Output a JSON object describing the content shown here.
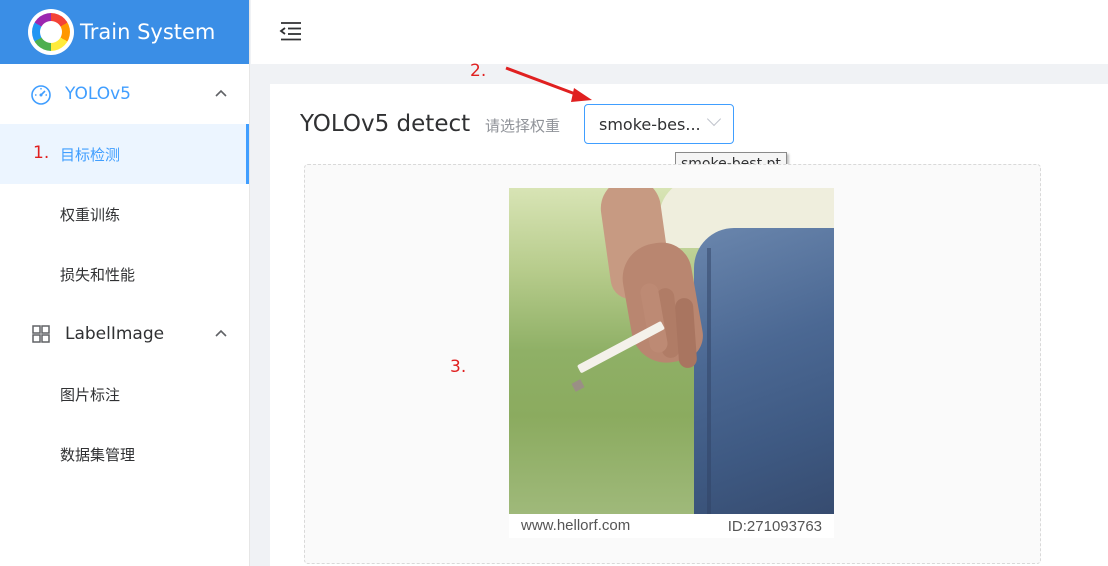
{
  "app": {
    "title": "Train System",
    "accent_color": "#409eff",
    "header_color": "#3a8ee6"
  },
  "sidebar": {
    "groups": [
      {
        "label": "YOLOv5",
        "icon": "dashboard-gauge-icon",
        "expanded": true,
        "items": [
          {
            "label": "目标检测",
            "active": true
          },
          {
            "label": "权重训练",
            "active": false
          },
          {
            "label": "损失和性能",
            "active": false
          }
        ]
      },
      {
        "label": "LabelImage",
        "icon": "grid-icon",
        "expanded": true,
        "items": [
          {
            "label": "图片标注",
            "active": false
          },
          {
            "label": "数据集管理",
            "active": false
          }
        ]
      }
    ]
  },
  "header": {
    "collapse_icon": "menu-fold-icon"
  },
  "main": {
    "title": "YOLOv5 detect",
    "weight_label": "请选择权重",
    "weight_select": {
      "value": "smoke-bes...",
      "tooltip": "smoke-best.pt"
    },
    "image": {
      "watermark_left": "www.hellorf.com",
      "watermark_right": "ID:271093763"
    }
  },
  "annotations": {
    "step1": "1.",
    "step2": "2.",
    "step3": "3.",
    "color": "#e02020"
  }
}
